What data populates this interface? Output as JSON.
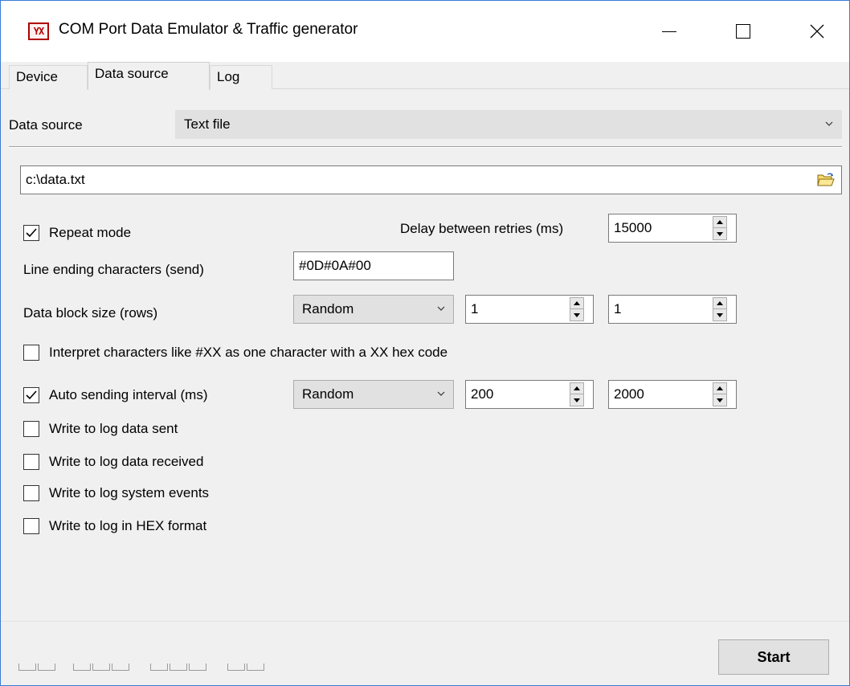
{
  "window": {
    "title": "COM Port Data Emulator & Traffic generator",
    "icon": "app-logo-icon",
    "icon_text": "YX",
    "controls": {
      "minimize": "minimize-icon",
      "maximize": "maximize-icon",
      "close": "close-icon"
    }
  },
  "tabs": [
    {
      "label": "Device",
      "active": false
    },
    {
      "label": "Data source",
      "active": true
    },
    {
      "label": "Log",
      "active": false
    }
  ],
  "data_source": {
    "label": "Data source",
    "selected": "Text file"
  },
  "file_path": {
    "value": "c:\\data.txt",
    "browse_icon": "folder-open-icon"
  },
  "repeat_mode": {
    "label": "Repeat mode",
    "checked": true
  },
  "delay_between_retries": {
    "label": "Delay between retries (ms)",
    "value": "15000"
  },
  "line_ending": {
    "label": "Line ending characters (send)",
    "value": "#0D#0A#00"
  },
  "data_block_size": {
    "label": "Data block size (rows)",
    "mode": "Random",
    "min": "1",
    "max": "1"
  },
  "interpret_hex": {
    "label": "Interpret characters like #XX as one character with a XX hex code",
    "checked": false
  },
  "auto_sending_interval": {
    "label": "Auto sending interval (ms)",
    "checked": true,
    "mode": "Random",
    "min": "200",
    "max": "2000"
  },
  "log_options": [
    {
      "label": "Write to log data sent",
      "checked": false
    },
    {
      "label": "Write to log data received",
      "checked": false
    },
    {
      "label": "Write to log system events",
      "checked": false
    },
    {
      "label": "Write to log in HEX format",
      "checked": false
    }
  ],
  "start_button": {
    "label": "Start"
  },
  "colors": {
    "window_bg": "#f0f0f0",
    "combo_bg": "#e1e1e1",
    "border_accent": "#3a7bd5",
    "icon_red": "#b00000"
  }
}
